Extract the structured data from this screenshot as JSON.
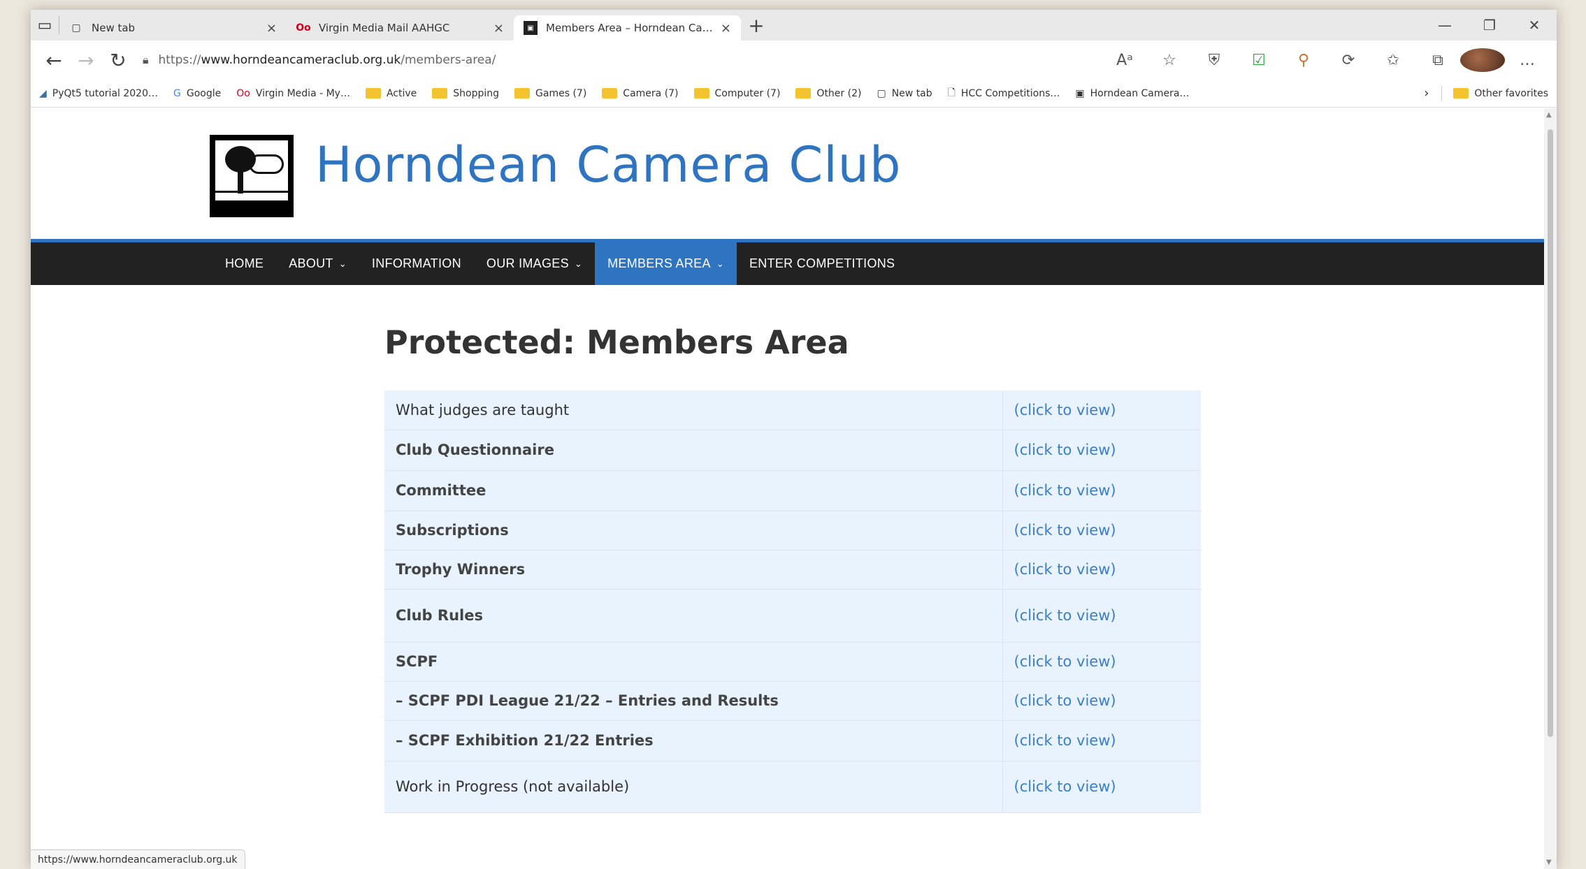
{
  "browser": {
    "tabs": [
      {
        "title": "New tab",
        "icon": "new-tab-icon"
      },
      {
        "title": "Virgin Media Mail AAHGC",
        "icon": "virgin-media-icon"
      },
      {
        "title": "Members Area – Horndean Cam…",
        "icon": "site-favicon"
      }
    ],
    "url": "https://www.horndeancameraclub.org.uk/members-area/",
    "bookmarks": [
      {
        "label": "PyQt5 tutorial 2020…",
        "icon": "python-icon"
      },
      {
        "label": "Google",
        "icon": "google-icon"
      },
      {
        "label": "Virgin Media - My…",
        "icon": "virgin-media-icon"
      },
      {
        "label": "Active",
        "icon": "folder-icon"
      },
      {
        "label": "Shopping",
        "icon": "folder-icon"
      },
      {
        "label": "Games (7)",
        "icon": "folder-icon"
      },
      {
        "label": "Camera (7)",
        "icon": "folder-icon"
      },
      {
        "label": "Computer (7)",
        "icon": "folder-icon"
      },
      {
        "label": "Other (2)",
        "icon": "folder-icon"
      },
      {
        "label": "New tab",
        "icon": "new-tab-icon"
      },
      {
        "label": "HCC Competitions…",
        "icon": "page-icon"
      },
      {
        "label": "Horndean Camera…",
        "icon": "site-favicon"
      }
    ],
    "other_favorites": "Other favorites",
    "status_url": "https://www.horndeancameraclub.org.uk"
  },
  "site": {
    "title": "Horndean Camera Club",
    "accent": "#2f74c0",
    "nav": [
      {
        "label": "HOME",
        "dropdown": false,
        "active": false
      },
      {
        "label": "ABOUT",
        "dropdown": true,
        "active": false
      },
      {
        "label": "INFORMATION",
        "dropdown": false,
        "active": false
      },
      {
        "label": "OUR IMAGES",
        "dropdown": true,
        "active": false
      },
      {
        "label": "MEMBERS AREA",
        "dropdown": true,
        "active": true
      },
      {
        "label": "ENTER COMPETITIONS",
        "dropdown": false,
        "active": false
      }
    ]
  },
  "page": {
    "title": "Protected: Members Area",
    "rows": [
      {
        "label": "What judges are taught",
        "link": "(click to view)",
        "bold": false
      },
      {
        "label": "Club Questionnaire",
        "link": "(click to view)",
        "bold": true
      },
      {
        "label": "Committee",
        "link": "(click to view)",
        "bold": true
      },
      {
        "label": "Subscriptions",
        "link": "(click to view)",
        "bold": true
      },
      {
        "label": "Trophy Winners",
        "link": "(click to view)",
        "bold": true
      },
      {
        "label": "Club Rules",
        "link": "(click to view)",
        "bold": true
      },
      {
        "label": "SCPF",
        "link": "(click to view)",
        "bold": true
      },
      {
        "label": "– SCPF PDI League 21/22 – Entries and Results",
        "link": "(click to view)",
        "bold": true
      },
      {
        "label": "– SCPF Exhibition 21/22 Entries",
        "link": "(click to view)",
        "bold": true
      },
      {
        "label": "Work in Progress (not available)",
        "link": "(click to view)",
        "bold": false
      }
    ]
  }
}
